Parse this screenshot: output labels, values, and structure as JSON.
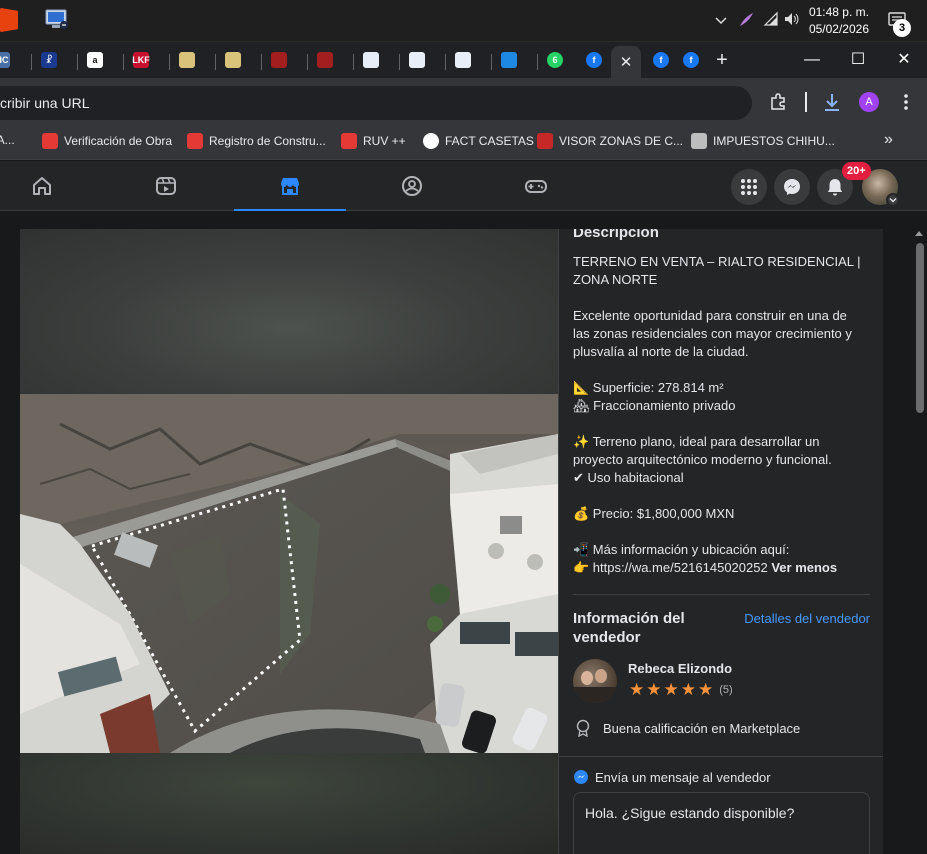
{
  "taskbar": {
    "time": "01:48 p. m.",
    "date": "05/02/2026",
    "notification_count": "3"
  },
  "browser": {
    "tabs": [
      {
        "name": "tab-ic",
        "color": "#4a6fa5",
        "label": "HC"
      },
      {
        "name": "tab-tool",
        "color": "#1a3a8f",
        "label": "☧"
      },
      {
        "name": "tab-amazon",
        "color": "#ffffff",
        "label": "a"
      },
      {
        "name": "tab-lkf",
        "color": "#c8102e",
        "label": "LKF"
      },
      {
        "name": "tab-sat-1",
        "color": "#d9c27a",
        "label": ""
      },
      {
        "name": "tab-sat-2",
        "color": "#d9c27a",
        "label": ""
      },
      {
        "name": "tab-red-1",
        "color": "#a31f1f",
        "label": ""
      },
      {
        "name": "tab-red-2",
        "color": "#a31f1f",
        "label": ""
      },
      {
        "name": "tab-doc-1",
        "color": "#e8eef8",
        "label": ""
      },
      {
        "name": "tab-doc-2",
        "color": "#e8eef8",
        "label": ""
      },
      {
        "name": "tab-doc-3",
        "color": "#e8eef8",
        "label": ""
      },
      {
        "name": "tab-onedrive",
        "color": "#1e88e5",
        "label": ""
      },
      {
        "name": "tab-whatsapp",
        "color": "#25d366",
        "label": "6"
      },
      {
        "name": "tab-facebook-1",
        "color": "#1877f2",
        "label": "f"
      }
    ],
    "tabs_after_active": [
      {
        "name": "tab-facebook-3",
        "color": "#1877f2",
        "label": "f"
      },
      {
        "name": "tab-facebook-4",
        "color": "#1877f2",
        "label": "f"
      }
    ],
    "new_tab": "+",
    "address_placeholder": "cribir una URL",
    "profile_initial": "A",
    "bookmarks": [
      {
        "name": "bookmark-ca",
        "label": "CA...",
        "color": "#444"
      },
      {
        "name": "bookmark-verificacion",
        "label": "Verificación de Obra",
        "color": "#e53935"
      },
      {
        "name": "bookmark-registro",
        "label": "Registro de Constru...",
        "color": "#e53935"
      },
      {
        "name": "bookmark-ruv",
        "label": "RUV ++",
        "color": "#e53935"
      },
      {
        "name": "bookmark-fact-casetas",
        "label": "FACT CASETAS",
        "color": "#ffffff"
      },
      {
        "name": "bookmark-visor-zonas",
        "label": "VISOR ZONAS DE C...",
        "color": "#c62828"
      },
      {
        "name": "bookmark-impuestos",
        "label": "IMPUESTOS CHIHU...",
        "color": "#bdbdbd"
      }
    ],
    "more_bookmarks": "»"
  },
  "facebook": {
    "notification_badge": "20+",
    "description_title": "Descripción",
    "description_paragraphs": [
      "TERRENO EN VENTA – RIALTO RESIDENCIAL | ZONA NORTE",
      "Excelente oportunidad para construir en una de las zonas residenciales con mayor crecimiento y plusvalía al norte de la ciudad.",
      "📐 Superficie: 278.814 m²\n🏘 Fraccionamiento privado",
      "✨ Terreno plano, ideal para desarrollar un proyecto arquitectónico moderno y funcional.\n✔ Uso habitacional",
      "💰 Precio: $1,800,000 MXN"
    ],
    "contact_line": "📲 Más información y ubicación aquí:",
    "contact_link": "👉 https://wa.me/5216145020252",
    "see_less": "Ver menos",
    "seller_section_title": "Información del vendedor",
    "seller_details_link": "Detalles del vendedor",
    "seller_name": "Rebeca Elizondo",
    "seller_rating": 5,
    "seller_review_count": "(5)",
    "seller_badge": "Buena calificación en Marketplace",
    "message_title": "Envía un mensaje al vendedor",
    "message_default": "Hola. ¿Sigue estando disponible?"
  }
}
